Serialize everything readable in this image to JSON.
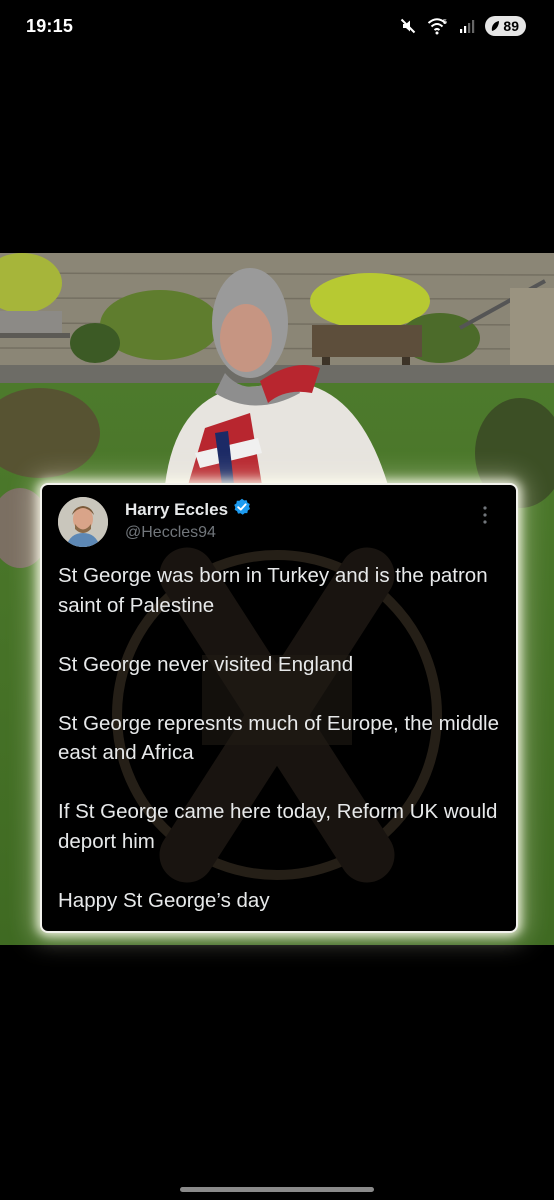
{
  "status_bar": {
    "time": "19:15",
    "battery_level": "89",
    "icons": [
      "mute-icon",
      "wifi-icon",
      "signal-icon",
      "battery-saver-icon"
    ]
  },
  "photo": {
    "description_icon": "photo"
  },
  "tweet": {
    "author_name": "Harry Eccles",
    "author_handle": "@Heccles94",
    "verified": true,
    "verified_color": "#1d9bf0",
    "paragraphs": [
      "St George was born in Turkey and is the patron saint of Palestine",
      "St George never visited England",
      "St George represnts much of Europe, the middle east and Africa",
      "If St George came here today, Reform UK would deport him",
      "Happy St George’s day"
    ]
  },
  "colors": {
    "background": "#000000",
    "tweet_text": "#e7e9ea",
    "handle_text": "#71767b"
  }
}
